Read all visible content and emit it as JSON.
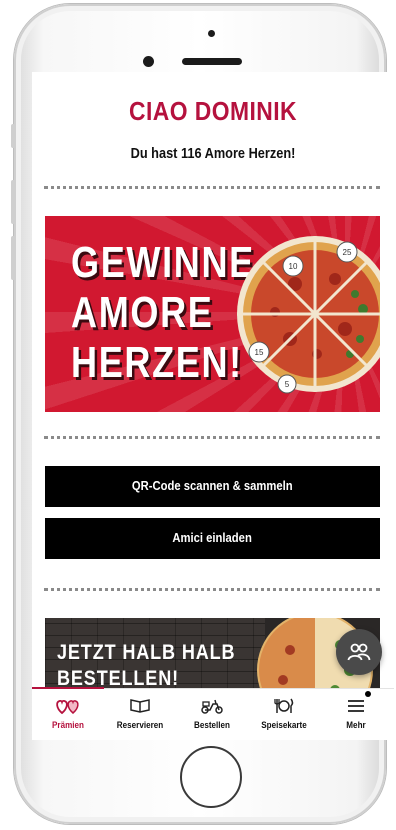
{
  "header": {
    "greeting": "CIAO DOMINIK",
    "points_text": "Du hast 116 Amore Herzen!"
  },
  "promo_banner": {
    "lines": [
      "GEWINNE",
      "AMORE",
      "HERZEN!"
    ],
    "pizza_numbers": [
      "10",
      "25",
      "15",
      "5"
    ],
    "carousel_pages": 2,
    "carousel_active_index": 0
  },
  "actions": {
    "scan_label": "QR-Code scannen & sammeln",
    "invite_label": "Amici einladen"
  },
  "second_banner": {
    "lines": [
      "JETZT HALB HALB",
      "BESTELLEN!"
    ]
  },
  "fab": {
    "icon": "people-icon"
  },
  "tabbar": {
    "items": [
      {
        "label": "Prämien",
        "icon": "hearts-icon",
        "active": true
      },
      {
        "label": "Reservieren",
        "icon": "book-icon",
        "active": false
      },
      {
        "label": "Bestellen",
        "icon": "scooter-icon",
        "active": false
      },
      {
        "label": "Speisekarte",
        "icon": "cutlery-icon",
        "active": false
      },
      {
        "label": "Mehr",
        "icon": "menu-icon",
        "active": false
      }
    ]
  },
  "colors": {
    "brand_red": "#b5123e",
    "banner_red": "#d11830",
    "button_black": "#000000"
  }
}
